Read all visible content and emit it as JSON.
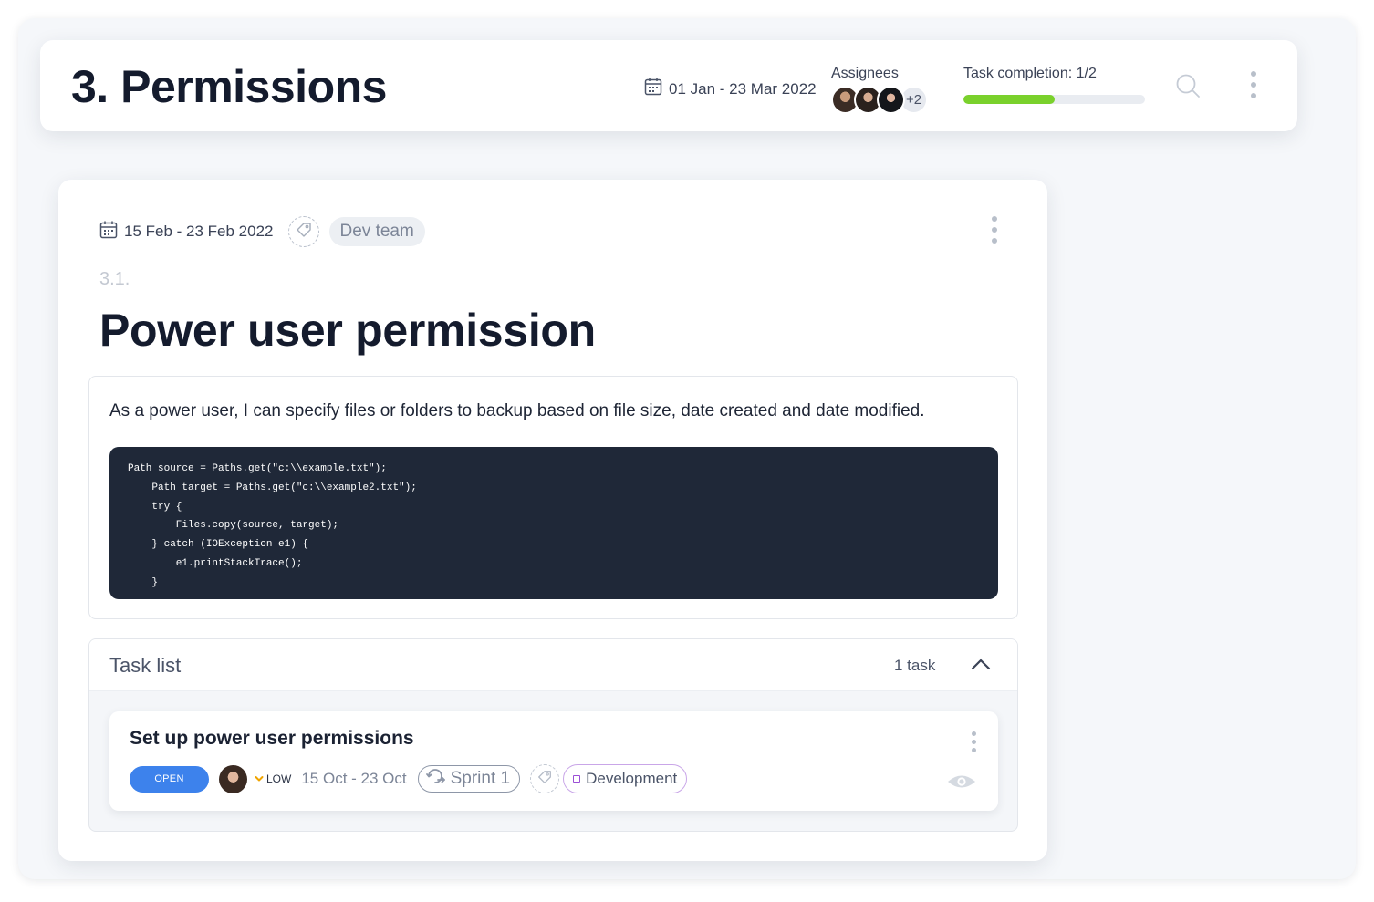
{
  "header": {
    "title": "3. Permissions",
    "date_range": "01 Jan - 23 Mar 2022",
    "assignees_label": "Assignees",
    "assignees_extra": "+2",
    "completion_label": "Task completion: 1/2",
    "completion_fraction": 0.5,
    "icons": [
      "calendar-icon",
      "search-icon",
      "more-vertical-icon"
    ]
  },
  "story": {
    "date_range": "15 Feb - 23 Feb 2022",
    "team": "Dev team",
    "number": "3.1.",
    "title": "Power user permission",
    "description": "As a power user, I can specify files or folders to backup based on file size, date created and date modified.",
    "code_lines": [
      "Path source = Paths.get(\"c:\\\\example.txt\");",
      "    Path target = Paths.get(\"c:\\\\example2.txt\");",
      "    try {",
      "        Files.copy(source, target);",
      "    } catch (IOException e1) {",
      "        e1.printStackTrace();",
      "    }"
    ]
  },
  "task_list": {
    "title": "Task list",
    "count": "1 task",
    "tasks": [
      {
        "title": "Set up power user permissions",
        "status": "OPEN",
        "priority": "LOW",
        "dates": "15 Oct - 23 Oct",
        "sprint": "Sprint 1",
        "label": "Development"
      }
    ]
  },
  "colors": {
    "progress": "#7ad12c",
    "status_open": "#3d82ec",
    "priority_low": "#f0a400",
    "label_development": "#9b4fd6",
    "code_bg": "#1f2838"
  }
}
